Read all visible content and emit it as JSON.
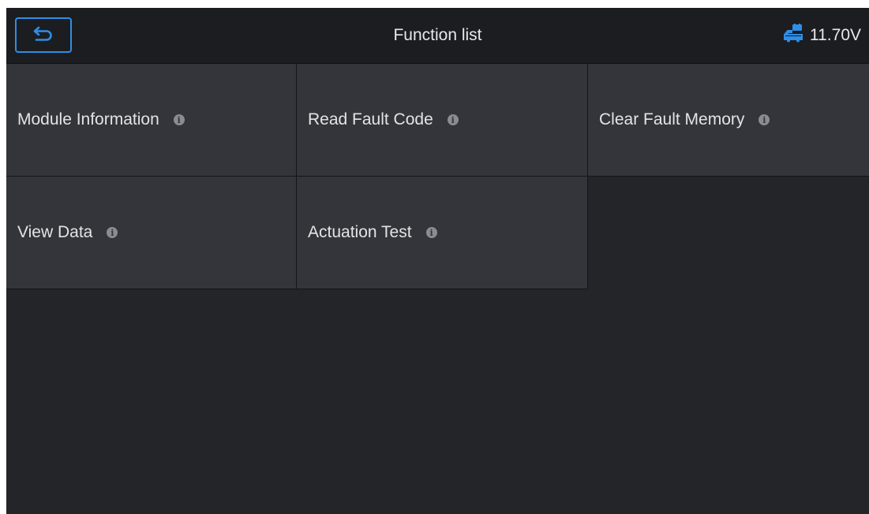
{
  "header": {
    "title": "Function list",
    "voltage": "11.70V",
    "back_icon": "back-arrow-icon",
    "battery_icon": "vehicle-battery-icon",
    "accent_color": "#2f8ee6"
  },
  "functions": [
    {
      "label": "Module Information",
      "info_icon": "info-icon"
    },
    {
      "label": "Read Fault Code",
      "info_icon": "info-icon"
    },
    {
      "label": "Clear Fault Memory",
      "info_icon": "info-icon"
    },
    {
      "label": "View Data",
      "info_icon": "info-icon"
    },
    {
      "label": "Actuation Test",
      "info_icon": "info-icon"
    }
  ]
}
